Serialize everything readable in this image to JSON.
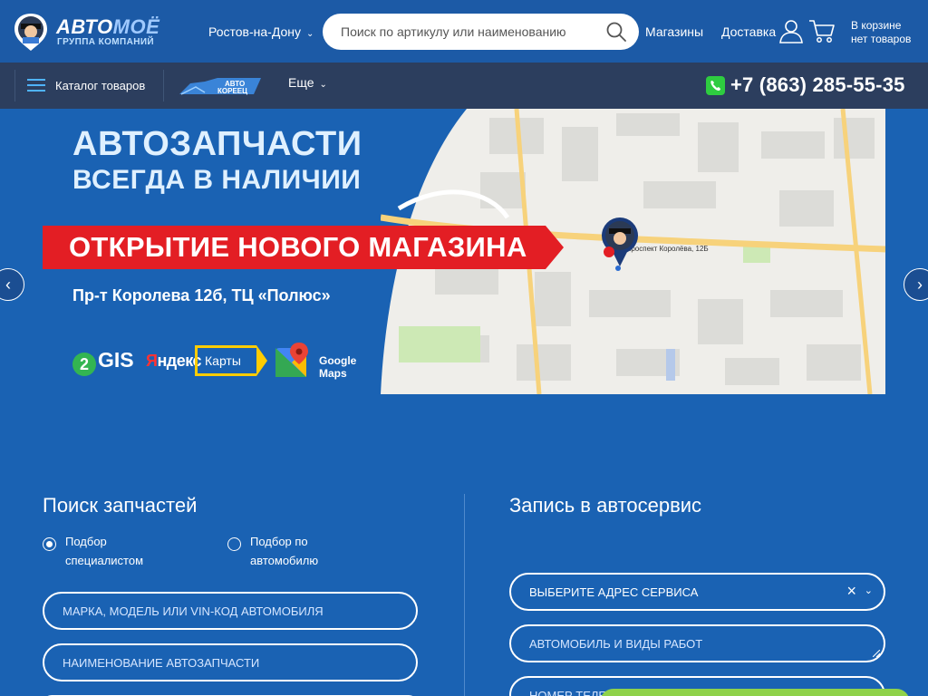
{
  "header": {
    "logo": {
      "brand_part1": "АВТО",
      "brand_part2": "МОЁ",
      "subtitle": "ГРУППА КОМПАНИЙ"
    },
    "city": "Ростов-на-Дону",
    "search_placeholder": "Поиск по артикулу или наименованию",
    "links": {
      "stores": "Магазины",
      "delivery": "Доставка"
    },
    "cart": {
      "line1": "В корзине",
      "line2": "нет товаров"
    }
  },
  "subbar": {
    "catalog": "Каталог товаров",
    "partner_logo_top": "АВТО",
    "partner_logo_bottom": "КОРЕЕЦ",
    "more": "Еще",
    "phone": "+7 (863) 285-55-35"
  },
  "banner": {
    "title_line1": "АВТОЗАПЧАСТИ",
    "title_line2": "ВСЕГДА В НАЛИЧИИ",
    "promo": "ОТКРЫТИЕ НОВОГО МАГАЗИНА",
    "address": "Пр-т Королева 12б, ТЦ «Полюс»",
    "map_label": "проспект Королёва, 12Б",
    "brands": {
      "gis": "GIS",
      "gis_digit": "2",
      "yandex_y": "Я",
      "yandex_rest": "ндекс",
      "karty": "Карты",
      "google_maps": "Google Maps"
    }
  },
  "parts_search": {
    "title": "Поиск запчастей",
    "radio1": [
      "Подбор",
      "специалистом"
    ],
    "radio2": [
      "Подбор по",
      "автомобилю"
    ],
    "field1_placeholder": "МАРКА, МОДЕЛЬ ИЛИ VIN-КОД АВТОМОБИЛЯ",
    "field2_placeholder": "НАИМЕНОВАНИЕ АВТОЗАПЧАСТИ"
  },
  "service": {
    "title": "Запись в автосервис",
    "select_value": "ВЫБЕРИТЕ АДРЕС СЕРВИСА",
    "field2_placeholder": "АВТОМОБИЛЬ И ВИДЫ РАБОТ",
    "field3_placeholder": "НОМЕР ТЕЛЕФОНА"
  },
  "colors": {
    "header_bg": "#1c5aa6",
    "subbar_bg": "#2c3e5e",
    "page_bg": "#1a62b3",
    "promo_red": "#e31e24",
    "whatsapp_green": "#2ecc40"
  }
}
